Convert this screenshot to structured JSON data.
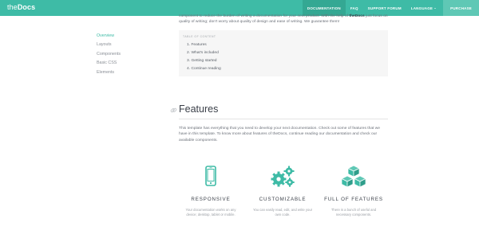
{
  "brand": {
    "the": "the",
    "docs": "Docs"
  },
  "nav": {
    "items": [
      {
        "label": "DOCUMENTATION"
      },
      {
        "label": "FAQ"
      },
      {
        "label": "SUPPORT FORUM"
      },
      {
        "label": "LANGUAGE"
      },
      {
        "label": "PURCHASE"
      }
    ]
  },
  "sidebar": {
    "items": [
      {
        "label": "Overview"
      },
      {
        "label": "Layouts"
      },
      {
        "label": "Components"
      },
      {
        "label": "Basic CSS"
      },
      {
        "label": "Elements"
      }
    ]
  },
  "intro": {
    "line1": "component to reduce the burden of writing a documentation for your next product. With the help of ",
    "bold": "theDocs",
    "line2": " just focus on quality of writing; don't worry about quality of design and ease of writing. We guarantee them!"
  },
  "toc": {
    "title": "TABLE OF CONTENT",
    "items": [
      {
        "label": "1.  Features"
      },
      {
        "label": "2.  What's included"
      },
      {
        "label": "3.  Getting started"
      },
      {
        "label": "4.  Continue reading"
      }
    ]
  },
  "features": {
    "title": "Features",
    "description": "This template has everything that you need to develop your next documentation. Check out some of features that we have in this template. To know more about features of theDocs, continue reading our documentation and check our available components.",
    "cards": [
      {
        "title": "RESPONSIVE",
        "desc": "Your documentation works on any device; desktop, tablet or mobile.",
        "icon": "mobile-phone-icon"
      },
      {
        "title": "CUSTOMIZABLE",
        "desc": "You can easily read, edit, and write your own code.",
        "icon": "gears-icon"
      },
      {
        "title": "FULL OF FEATURES",
        "desc": "There is a bunch of useful and necessary components.",
        "icon": "cubes-icon"
      }
    ]
  },
  "colors": {
    "accent": "#3ebba6",
    "accent_dark": "#34a893",
    "accent_light": "#5fc8b5",
    "heading": "#3b4049",
    "text": "#6b7079"
  }
}
